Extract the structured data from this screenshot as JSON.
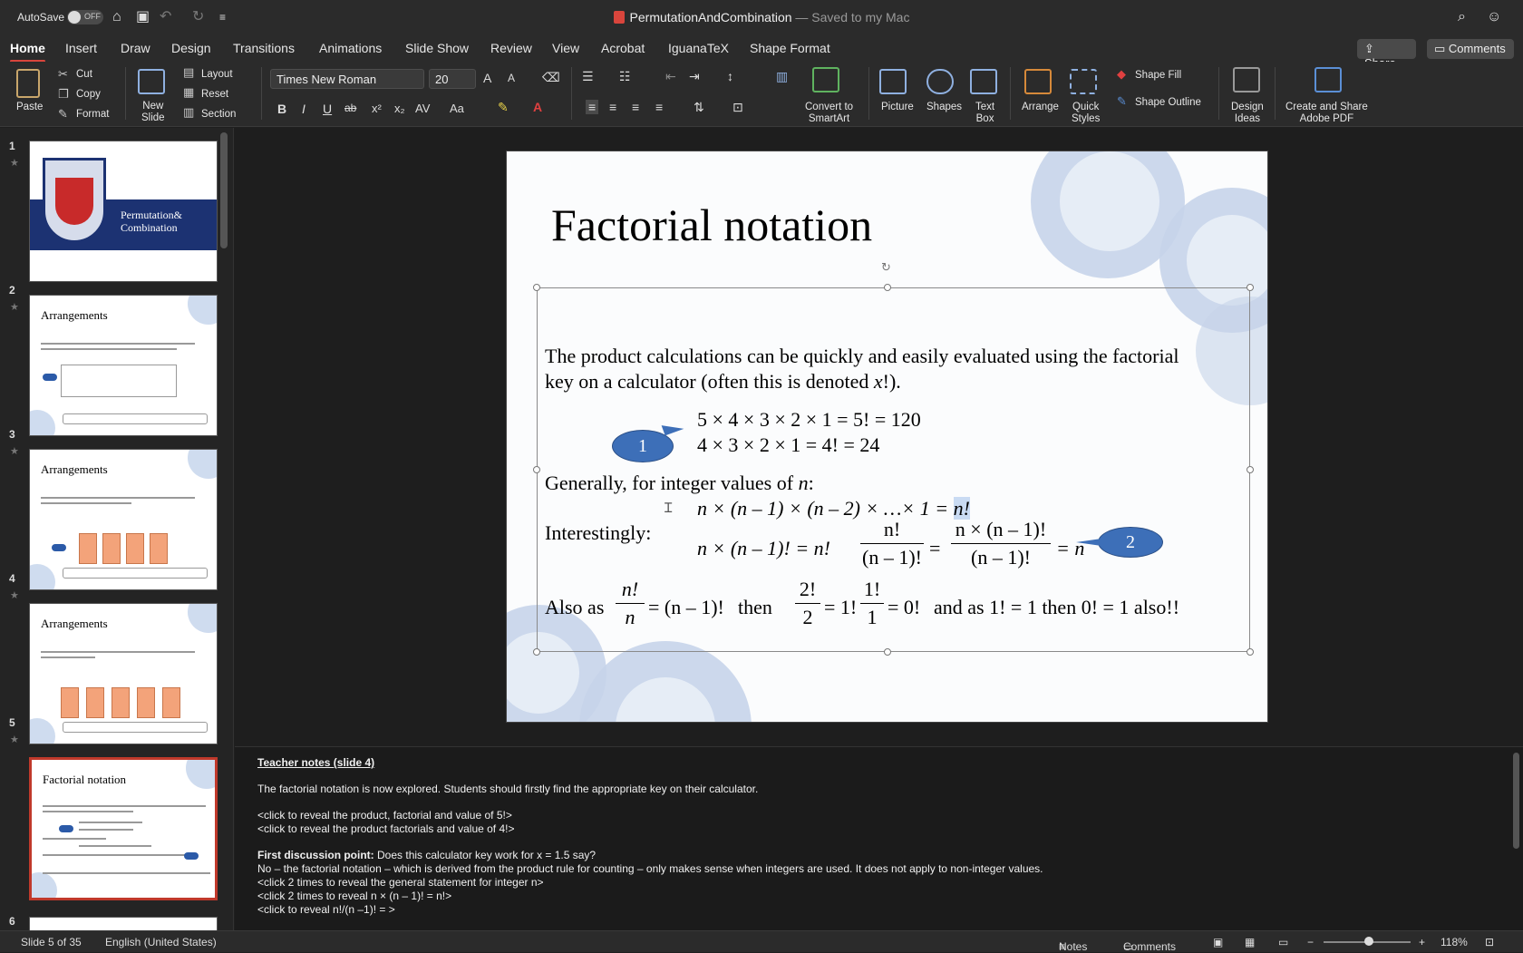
{
  "titlebar": {
    "autosave_label": "AutoSave",
    "autosave_state": "OFF",
    "doc_name": "PermutationAndCombination",
    "save_state": "— Saved to my Mac"
  },
  "ribbon_tabs": [
    "Home",
    "Insert",
    "Draw",
    "Design",
    "Transitions",
    "Animations",
    "Slide Show",
    "Review",
    "View",
    "Acrobat",
    "IguanaTeX",
    "Shape Format"
  ],
  "top_buttons": {
    "share": "Share",
    "comments": "Comments"
  },
  "ribbon": {
    "paste": "Paste",
    "cut": "Cut",
    "copy": "Copy",
    "format": "Format",
    "new_slide": [
      "New",
      "Slide"
    ],
    "layout": "Layout",
    "reset": "Reset",
    "section": "Section",
    "font_name": "Times New Roman",
    "font_size": "20",
    "convert_smartart": [
      "Convert to",
      "SmartArt"
    ],
    "picture": "Picture",
    "shapes": "Shapes",
    "text_box": [
      "Text",
      "Box"
    ],
    "arrange": "Arrange",
    "quick_styles": [
      "Quick",
      "Styles"
    ],
    "shape_fill": "Shape Fill",
    "shape_outline": "Shape Outline",
    "design_ideas": [
      "Design",
      "Ideas"
    ],
    "adobe_pdf": [
      "Create and Share",
      "Adobe PDF"
    ],
    "bold": "B",
    "italic": "I",
    "underline": "U",
    "strike": "ab",
    "superscript": "x²",
    "subscript": "x₂",
    "spacing": "AV",
    "case": "Aa",
    "grow_font": "A",
    "shrink_font": "A"
  },
  "thumbnails": [
    {
      "num": "1",
      "title": "",
      "subtitle_lines": [
        "Permutation&",
        "Combination"
      ]
    },
    {
      "num": "2",
      "title": "Arrangements"
    },
    {
      "num": "3",
      "title": "Arrangements"
    },
    {
      "num": "4",
      "title": "Arrangements"
    },
    {
      "num": "5",
      "title": "Factorial notation"
    },
    {
      "num": "6",
      "title": ""
    }
  ],
  "slide": {
    "title": "Factorial notation",
    "intro_line1": "The product calculations can be quickly and easily evaluated using the factorial",
    "intro_line2_prefix": "key on a calculator (often this is denoted ",
    "intro_line2_x": "x",
    "intro_line2_suffix": "!).",
    "eq1": "5 × 4 × 3 × 2 × 1 = 5! = 120",
    "eq2": "4 × 3 × 2 × 1 = 4! = 24",
    "bubble1": "1",
    "bubble2": "2",
    "general_prefix": "Generally, for integer values of ",
    "general_n": "n",
    "general_suffix": ":",
    "general_eq": "n × (n – 1) × (n – 2) × …× 1 = ",
    "general_eq_hl": "n!",
    "interestingly": "Interestingly:",
    "int_eq": "n × (n – 1)! = n!",
    "frac1_num": "n!",
    "frac1_den": "(n – 1)!",
    "frac2_num": "n × (n – 1)!",
    "frac2_den": "(n – 1)!",
    "eq_sign": "=",
    "eq_n": "= n",
    "also_as": "Also as",
    "frac3_num": "n!",
    "frac3_den": "n",
    "eq_n_minus_1": "= (n – 1)!",
    "then1": "then",
    "frac4_num": "2!",
    "frac4_den": "2",
    "eq_1": "= 1!",
    "frac5_num": "1!",
    "frac5_den": "1",
    "eq_0": "= 0!",
    "and_as": "and as 1! = 1  then 0! = 1 also!!"
  },
  "notes": {
    "heading": "Teacher notes (slide 4)",
    "line1": "The factorial notation is now explored. Students should firstly find the appropriate key on their calculator.",
    "line2": "<click to reveal the product, factorial and value of 5!>",
    "line3": "<click to reveal the product factorials and value of 4!>",
    "line4_bold": "First discussion point:",
    "line4_rest": " Does this calculator key work for x = 1.5 say?",
    "line5": "No – the factorial notation – which is derived from the product rule for counting – only makes sense when integers are used. It does not apply to non-integer values.",
    "line6": "<click 2 times to reveal the general statement for integer n>",
    "line7": "<click 2 times to reveal  n × (n – 1)! = n!>",
    "line8": "<click to reveal n!/(n –1)! = >"
  },
  "statusbar": {
    "slide_info": "Slide 5 of 35",
    "language": "English (United States)",
    "notes": "Notes",
    "comments": "Comments",
    "zoom": "118%"
  },
  "colors": {
    "accent": "#d9453c",
    "bubble": "#3d6fb8",
    "highlight": "#c9dbf3"
  }
}
